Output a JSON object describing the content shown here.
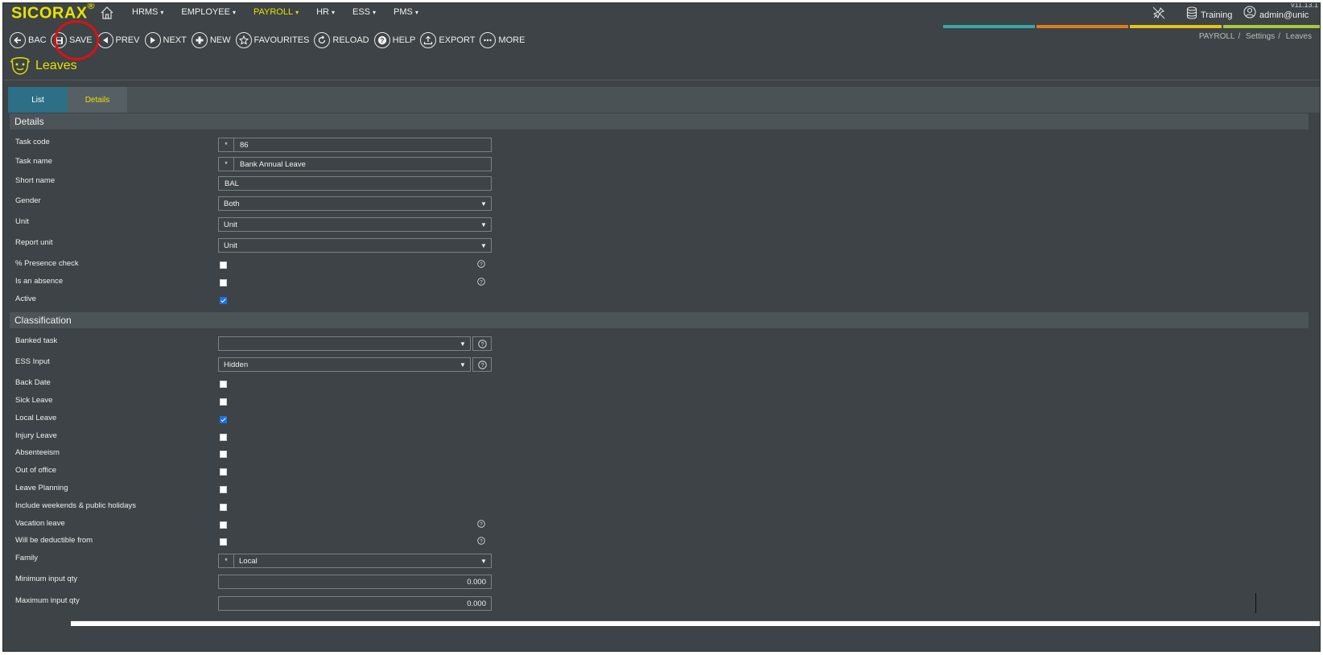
{
  "brand": {
    "name": "SICORAX",
    "mark": "®"
  },
  "version": "v11.13.1",
  "menu": [
    {
      "label": "HRMS",
      "active": false
    },
    {
      "label": "EMPLOYEE",
      "active": false
    },
    {
      "label": "PAYROLL",
      "active": true
    },
    {
      "label": "HR",
      "active": false
    },
    {
      "label": "ESS",
      "active": false
    },
    {
      "label": "PMS",
      "active": false
    }
  ],
  "top_right": {
    "database": "Training",
    "user": "admin@unic"
  },
  "colors": {
    "accent_yellow": "#e6e200",
    "teal": "#3aa6a8",
    "orange": "#e07b1a",
    "yellow": "#e6c21a",
    "lime": "#a7c93a",
    "tab_active": "#2c6f86"
  },
  "toolbar": {
    "back": "BACK",
    "save": "SAVE",
    "prev": "PREV",
    "next": "NEXT",
    "new": "NEW",
    "favourites": "FAVOURITES",
    "reload": "RELOAD",
    "help": "HELP",
    "export": "EXPORT",
    "more": "MORE"
  },
  "breadcrumb": [
    "PAYROLL",
    "Settings",
    "Leaves"
  ],
  "breadcrumb_sep": "/",
  "page_title": "Leaves",
  "tabs": {
    "list": "List",
    "details": "Details"
  },
  "sections": {
    "details": "Details",
    "classification": "Classification"
  },
  "required_mark": "*",
  "form": {
    "task_code": {
      "label": "Task code",
      "value": "86"
    },
    "task_name": {
      "label": "Task name",
      "value": "Bank Annual Leave"
    },
    "short_name": {
      "label": "Short name",
      "value": "BAL"
    },
    "gender": {
      "label": "Gender",
      "value": "Both"
    },
    "unit": {
      "label": "Unit",
      "value": "Unit"
    },
    "report_unit": {
      "label": "Report unit",
      "value": "Unit"
    },
    "presence_check": {
      "label": "% Presence check",
      "checked": false
    },
    "is_absence": {
      "label": "Is an absence",
      "checked": false
    },
    "active": {
      "label": "Active",
      "checked": true
    },
    "banked_task": {
      "label": "Banked task",
      "value": ""
    },
    "ess_input": {
      "label": "ESS Input",
      "value": "Hidden"
    },
    "back_date": {
      "label": "Back Date",
      "checked": false
    },
    "sick_leave": {
      "label": "Sick Leave",
      "checked": false
    },
    "local_leave": {
      "label": "Local Leave",
      "checked": true
    },
    "injury_leave": {
      "label": "Injury Leave",
      "checked": false
    },
    "absenteeism": {
      "label": "Absenteeism",
      "checked": false
    },
    "out_of_office": {
      "label": "Out of office",
      "checked": false
    },
    "leave_planning": {
      "label": "Leave Planning",
      "checked": false
    },
    "include_weekends": {
      "label": "Include weekends & public holidays",
      "checked": false
    },
    "vacation_leave": {
      "label": "Vacation leave",
      "checked": false
    },
    "deductible_from": {
      "label": "Will be deductible from",
      "checked": false
    },
    "family": {
      "label": "Family",
      "value": "Local"
    },
    "min_input_qty": {
      "label": "Minimum input qty",
      "value": "0.000"
    },
    "max_input_qty": {
      "label": "Maximum input qty",
      "value": "0.000"
    }
  }
}
